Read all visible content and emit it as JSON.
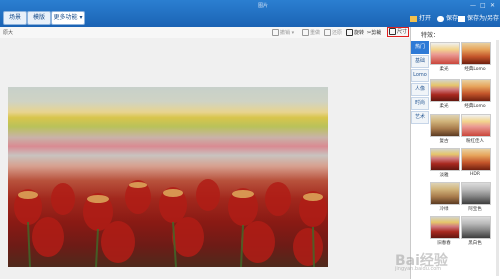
{
  "titlebar": {
    "tabs": [
      "场景",
      "模版",
      "更多功能"
    ],
    "title": "图片",
    "open_label": "打开",
    "save_label": "保存",
    "save_as_label": "保存为/另存"
  },
  "toolbar": {
    "zoom_label": "原大",
    "tools": [
      "撤销",
      "重做",
      "还原",
      "旋转",
      "剪裁",
      "尺寸"
    ]
  },
  "panel": {
    "header": "特效：",
    "categories": [
      "热门",
      "基础",
      "Lomo",
      "人像",
      "时尚",
      "艺术"
    ],
    "active_category": "热门",
    "effects": [
      "柔光",
      "经典Lomo",
      "柔光",
      "经典Lomo",
      "复古",
      "粉红佳人",
      "淡雅",
      "HDR",
      "冷绿",
      "阿宝色",
      "旧春春",
      "黑白色"
    ]
  },
  "watermark": {
    "text": "Bai经验",
    "sub": "jingyan.baidu.com"
  },
  "colors": {
    "accent": "#2e7ad6",
    "titlebar": "#1b63b4",
    "highlight": "#e02020"
  }
}
